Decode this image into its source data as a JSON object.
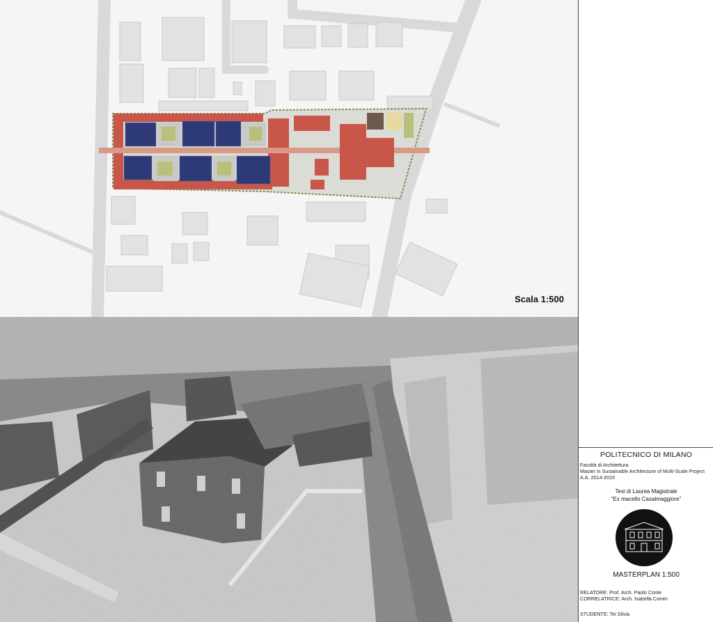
{
  "plan": {
    "scale_label": "Scala 1:500"
  },
  "title_block": {
    "university": "POLITECNICO DI MILANO",
    "faculty": "Facoltà di Architettura",
    "master": "Master in Sustainable Architecture of Multi-Scale Project",
    "academic_year": "A.A. 2014-2015",
    "thesis_type": "Tesi di Laurea Magistrale",
    "thesis_title": "“Ex macello Casalmaggiore”",
    "logo_icon": "building-facade-icon",
    "drawing_title": "MASTERPLAN 1:500",
    "relatore": "RELATORE: Prof. Arch. Paolo Conte",
    "correlatrice": "CORRELATRICE: Arch. Isabella Comin",
    "studente": "STUDENTE: Tei Silvia"
  },
  "colors": {
    "roof_red": "#c8574a",
    "solar_blue": "#2e3a78",
    "green_roof": "#b8c07a",
    "roads": "#dcdcdc",
    "buildings": "#e4e4e4"
  }
}
